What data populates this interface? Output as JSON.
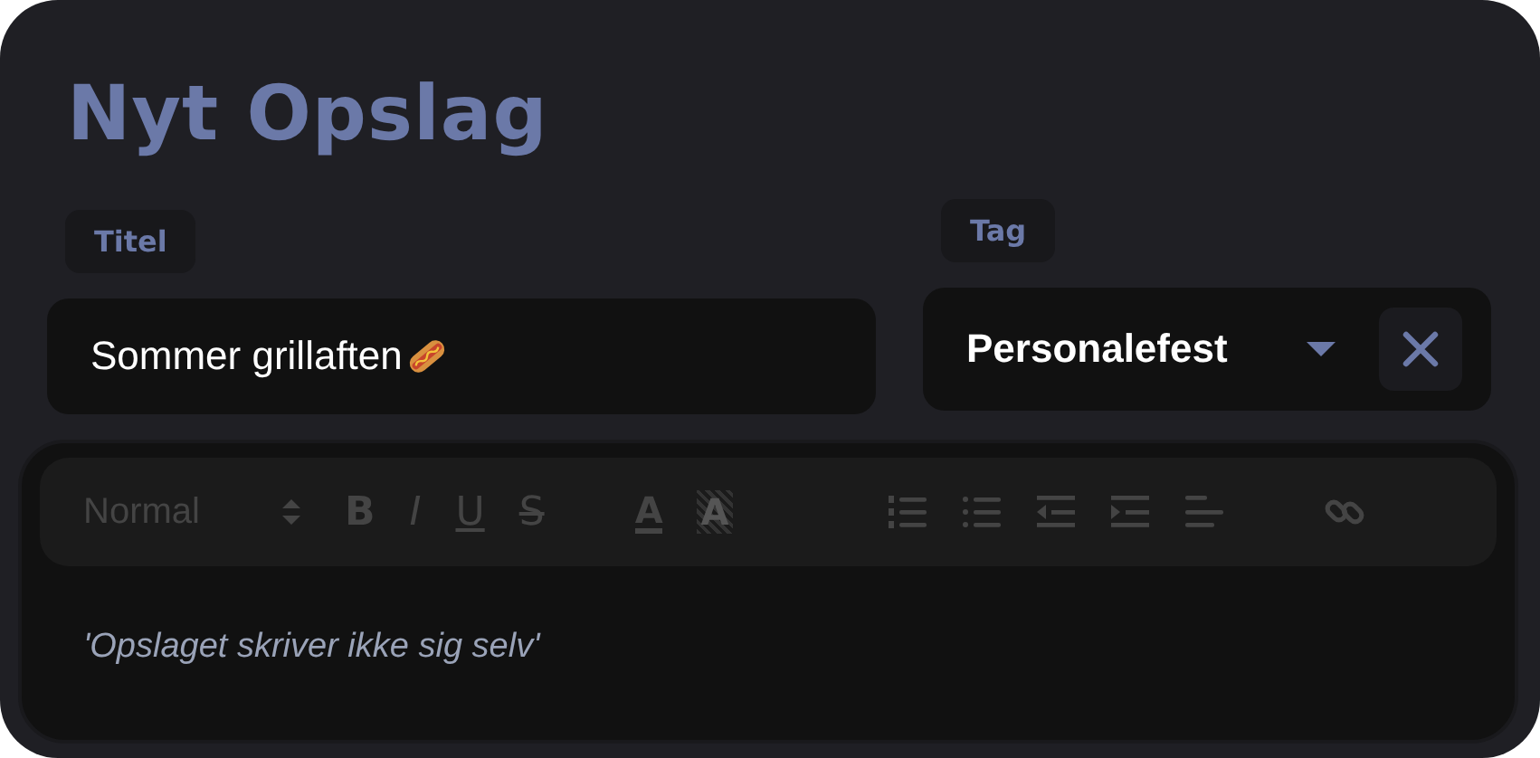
{
  "heading": "Nyt Opslag",
  "title_field": {
    "label": "Titel",
    "value": "Sommer grillaften"
  },
  "tag_field": {
    "label": "Tag",
    "value": "Personalefest"
  },
  "toolbar": {
    "format": "Normal",
    "tools": [
      {
        "kind": "bold",
        "text": "B"
      },
      {
        "kind": "italic",
        "text": "I"
      },
      {
        "kind": "underline",
        "text": "U"
      },
      {
        "kind": "strike",
        "text": "S"
      },
      {
        "kind": "color",
        "text": "A"
      },
      {
        "kind": "background",
        "text": "A"
      },
      {
        "kind": "ordered-list"
      },
      {
        "kind": "bullet-list"
      },
      {
        "kind": "outdent"
      },
      {
        "kind": "indent"
      },
      {
        "kind": "align"
      },
      {
        "kind": "link"
      }
    ]
  },
  "editor": {
    "placeholder": "'Opslaget skriver ikke sig selv'"
  }
}
